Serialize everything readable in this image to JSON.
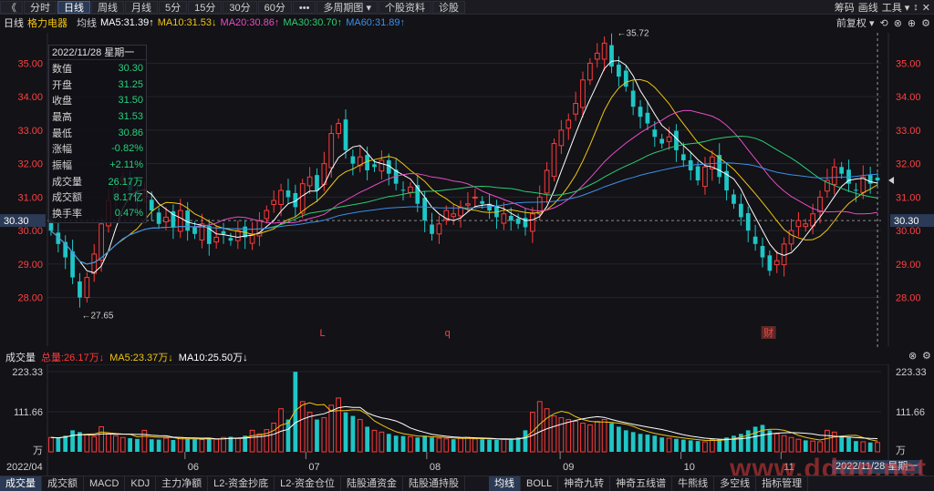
{
  "toolbar": {
    "back_label": "《",
    "tabs": [
      {
        "label": "分时",
        "active": false
      },
      {
        "label": "日线",
        "active": true
      },
      {
        "label": "周线",
        "active": false
      },
      {
        "label": "月线",
        "active": false
      },
      {
        "label": "5分",
        "active": false
      },
      {
        "label": "15分",
        "active": false
      },
      {
        "label": "30分",
        "active": false
      },
      {
        "label": "60分",
        "active": false
      },
      {
        "label": "•••",
        "active": false
      },
      {
        "label": "多周期图 ▾",
        "active": false
      },
      {
        "label": "个股资料",
        "active": false
      },
      {
        "label": "诊股",
        "active": false
      }
    ],
    "right": [
      "筹码",
      "画线",
      "工具 ▾",
      "↕",
      "✕"
    ]
  },
  "ma_header": {
    "period": "日线",
    "stock": "格力电器",
    "label": "均线",
    "items": [
      {
        "text": "MA5:31.39↑",
        "color": "#ffffff"
      },
      {
        "text": "MA10:31.53↓",
        "color": "#f1c40f"
      },
      {
        "text": "MA20:30.86↑",
        "color": "#e84cc2"
      },
      {
        "text": "MA30:30.70↑",
        "color": "#2ecc71"
      },
      {
        "text": "MA60:31.89↑",
        "color": "#3d8fe8"
      }
    ],
    "adjust": "前复权 ▾"
  },
  "info_panel": {
    "date": "2022/11/28  星期一",
    "rows": [
      {
        "k": "数值",
        "v": "30.30",
        "c": "down"
      },
      {
        "k": "开盘",
        "v": "31.25",
        "c": "down"
      },
      {
        "k": "收盘",
        "v": "31.50",
        "c": "down"
      },
      {
        "k": "最高",
        "v": "31.53",
        "c": "down"
      },
      {
        "k": "最低",
        "v": "30.86",
        "c": "down"
      },
      {
        "k": "涨幅",
        "v": "-0.82%",
        "c": "down"
      },
      {
        "k": "振幅",
        "v": "+2.11%",
        "c": "down"
      },
      {
        "k": "成交量",
        "v": "26.17万",
        "c": "down"
      },
      {
        "k": "成交额",
        "v": "8.17亿",
        "c": "down"
      },
      {
        "k": "换手率",
        "v": "0.47%",
        "c": "down"
      }
    ]
  },
  "price_axis": {
    "ticks": [
      "35.00",
      "34.00",
      "33.00",
      "32.00",
      "31.00",
      "30.00",
      "29.00",
      "28.00"
    ],
    "current": "30.30",
    "max_label": "35.72",
    "min_label": "27.65"
  },
  "markers": [
    "L",
    "q",
    "财"
  ],
  "months": [
    "2022/04",
    "06",
    "07",
    "08",
    "09",
    "10",
    "11"
  ],
  "volume_header": {
    "title": "成交量",
    "items": [
      {
        "text": "总量:26.17万↓",
        "color": "#ff3b3b"
      },
      {
        "text": "MA5:23.37万↓",
        "color": "#f1c40f"
      },
      {
        "text": "MA10:25.50万↓",
        "color": "#ffffff"
      }
    ]
  },
  "volume_axis": {
    "ticks": [
      "223.33",
      "111.66"
    ],
    "unit": "万"
  },
  "date_tag": "2022/11/28 星期一",
  "tabs": {
    "left": [
      "成交量",
      "成交额",
      "MACD",
      "KDJ",
      "主力净额",
      "L2-资金抄底",
      "L2-资金仓位",
      "陆股通资金",
      "陆股通持股"
    ],
    "right": [
      "均线",
      "BOLL",
      "神奇九转",
      "神奇五线谱",
      "牛熊线",
      "多空线",
      "指标管理"
    ]
  },
  "watermark": "www.ddgp.net",
  "chart_data": {
    "type": "candlestick",
    "title": "格力电器 日线",
    "ylim": [
      27.5,
      35.8
    ],
    "ma_values": {
      "MA5": 31.39,
      "MA10": 31.53,
      "MA20": 30.86,
      "MA30": 30.7,
      "MA60": 31.89
    },
    "closes": [
      30.0,
      29.6,
      29.2,
      28.6,
      28.0,
      28.6,
      29.3,
      30.2,
      30.9,
      31.3,
      31.6,
      31.2,
      30.9,
      31.1,
      30.6,
      30.2,
      30.4,
      30.1,
      30.6,
      30.0,
      29.9,
      30.2,
      29.6,
      29.8,
      29.9,
      29.7,
      30.0,
      29.8,
      29.9,
      30.3,
      30.6,
      30.9,
      31.2,
      31.0,
      30.7,
      31.4,
      31.6,
      31.2,
      32.0,
      32.9,
      33.2,
      32.4,
      32.0,
      32.2,
      31.8,
      31.9,
      32.1,
      31.7,
      31.4,
      31.2,
      31.3,
      30.8,
      30.3,
      29.9,
      30.2,
      30.6,
      30.5,
      30.7,
      30.8,
      31.0,
      30.8,
      30.6,
      30.4,
      30.5,
      30.3,
      30.2,
      30.1,
      30.5,
      31.0,
      31.8,
      32.6,
      33.0,
      33.3,
      33.8,
      34.5,
      35.0,
      35.3,
      35.6,
      34.9,
      34.6,
      34.3,
      33.7,
      33.4,
      33.2,
      32.8,
      32.6,
      32.8,
      32.4,
      32.1,
      31.8,
      31.5,
      31.9,
      32.2,
      31.6,
      31.2,
      30.8,
      30.4,
      30.0,
      29.6,
      29.2,
      28.8,
      29.1,
      29.6,
      30.0,
      30.3,
      30.2,
      30.5,
      31.0,
      31.5,
      31.9,
      31.7,
      31.4,
      31.2,
      31.6,
      31.4,
      31.5
    ],
    "volumes": [
      40,
      38,
      45,
      60,
      55,
      48,
      42,
      70,
      50,
      45,
      40,
      38,
      36,
      60,
      35,
      34,
      38,
      33,
      40,
      36,
      35,
      34,
      38,
      36,
      40,
      42,
      38,
      45,
      60,
      50,
      62,
      80,
      120,
      90,
      223,
      140,
      110,
      90,
      95,
      130,
      150,
      110,
      100,
      90,
      70,
      60,
      55,
      50,
      45,
      44,
      42,
      40,
      45,
      40,
      38,
      36,
      35,
      38,
      40,
      36,
      35,
      34,
      33,
      35,
      36,
      40,
      60,
      110,
      140,
      120,
      100,
      95,
      90,
      85,
      80,
      75,
      85,
      90,
      80,
      70,
      60,
      55,
      50,
      48,
      45,
      40,
      38,
      36,
      34,
      32,
      30,
      28,
      34,
      36,
      40,
      45,
      50,
      60,
      70,
      75,
      60,
      50,
      45,
      40,
      35,
      32,
      30,
      28,
      60,
      55,
      45,
      40,
      30,
      28,
      26,
      26
    ]
  }
}
